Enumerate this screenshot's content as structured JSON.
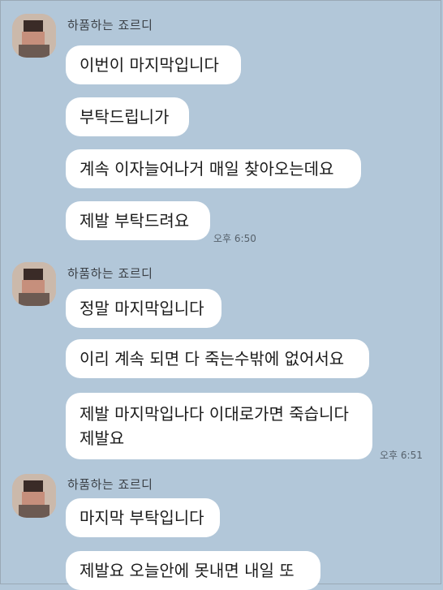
{
  "chat": {
    "groups": [
      {
        "sender": "하품하는 죠르디",
        "messages": [
          "이번이 마지막입니다",
          "부탁드립니가",
          "계속 이자늘어나거 매일 찾아오는데요",
          "제발 부탁드려요"
        ],
        "time": "오후 6:50"
      },
      {
        "sender": "하품하는 죠르디",
        "messages": [
          "정말 마지막입니다",
          "이리 계속 되면 다 죽는수밖에 없어서요",
          "제발 마지막입나다 이대로가면 죽습니다\n제발요"
        ],
        "time": "오후 6:51"
      },
      {
        "sender": "하품하는 죠르디",
        "messages": [
          "마지막 부탁입니다",
          "제발요 오늘안에 못내면 내일 또"
        ]
      }
    ]
  },
  "colors": {
    "background": "#b2c7d9",
    "bubble": "#ffffff",
    "text": "#1b1b1b"
  }
}
